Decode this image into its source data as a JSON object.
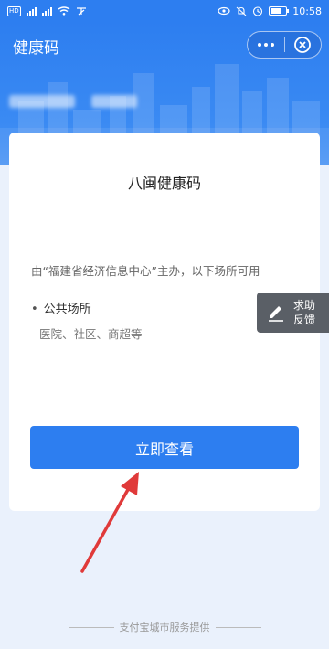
{
  "status_bar": {
    "hd_label": "HD",
    "time": "10:58"
  },
  "header": {
    "title": "健康码"
  },
  "card": {
    "title": "八闽健康码",
    "description": "由“福建省经济信息中心”主办，以下场所可用",
    "venue_label": "公共场所",
    "venue_examples": "医院、社区、商超等",
    "button_label": "立即查看"
  },
  "feedback": {
    "line1": "求助",
    "line2": "反馈"
  },
  "footer": {
    "text": "支付宝城市服务提供"
  },
  "colors": {
    "primary": "#2d7ef0",
    "background": "#eaf1fc",
    "feedback_bg": "#5a5f66",
    "arrow": "#e03a3a"
  }
}
